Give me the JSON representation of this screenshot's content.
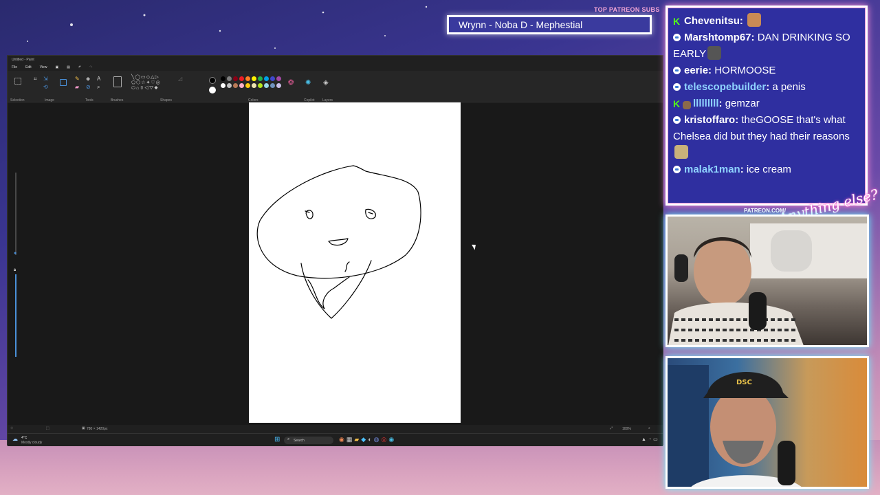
{
  "overlay": {
    "subs_title": "TOP PATREON SUBS",
    "subs_names": "Wrynn -  Noba D - Mephestial",
    "patreon_label": "PATREON.COM/",
    "script_text": "Anything else?"
  },
  "paint": {
    "window_title": "Untitled - Paint",
    "menu": [
      "File",
      "Edit",
      "View"
    ],
    "ribbon_groups": [
      "Selection",
      "Image",
      "Tools",
      "Brushes",
      "Shapes",
      "Colors",
      "Copilot",
      "Layers"
    ],
    "status_size": "780 × 1420px",
    "zoom": "100%",
    "weather_temp": "4°C",
    "weather_desc": "Mostly cloudy",
    "search_label": "Search",
    "colors_row1": [
      "#000000",
      "#7f7f7f",
      "#880015",
      "#ed1c24",
      "#ff7f27",
      "#fff200",
      "#22b14c",
      "#00a2e8",
      "#3f48cc",
      "#a349a4"
    ],
    "colors_row2": [
      "#ffffff",
      "#c3c3c3",
      "#b97a57",
      "#ffaec9",
      "#ffc90e",
      "#efe4b0",
      "#b5e61d",
      "#99d9ea",
      "#7092be",
      "#c8bfe7"
    ]
  },
  "chat": {
    "messages": [
      {
        "badge": "kick",
        "user": "Chevenitsu",
        "text": "",
        "emote": "#c98a55",
        "user_color": "#ffffff"
      },
      {
        "badge": "chat",
        "user": "Marshtomp67",
        "text": "DAN DRINKING SO EARLY",
        "emote": "#555555",
        "user_color": "#ffffff"
      },
      {
        "badge": "chat",
        "user": "eerie",
        "text": "HORMOOSE",
        "emote": "",
        "user_color": "#ffffff"
      },
      {
        "badge": "chat",
        "user": "telescopebuilder",
        "text": "a penis",
        "emote": "",
        "user_color": "#8fd3ff"
      },
      {
        "badge": "kick2",
        "user": "lllllllll",
        "text": "gemzar",
        "emote": "",
        "user_color": "#8fd3ff"
      },
      {
        "badge": "chat",
        "user": "kristoffaro",
        "text": "theGOOSE that's what Chelsea did but they had their reasons",
        "emote": "#c9b27a",
        "user_color": "#ffffff"
      },
      {
        "badge": "chat",
        "user": "malak1man",
        "text": "ice cream",
        "emote": "",
        "user_color": "#8fd3ff"
      }
    ]
  }
}
